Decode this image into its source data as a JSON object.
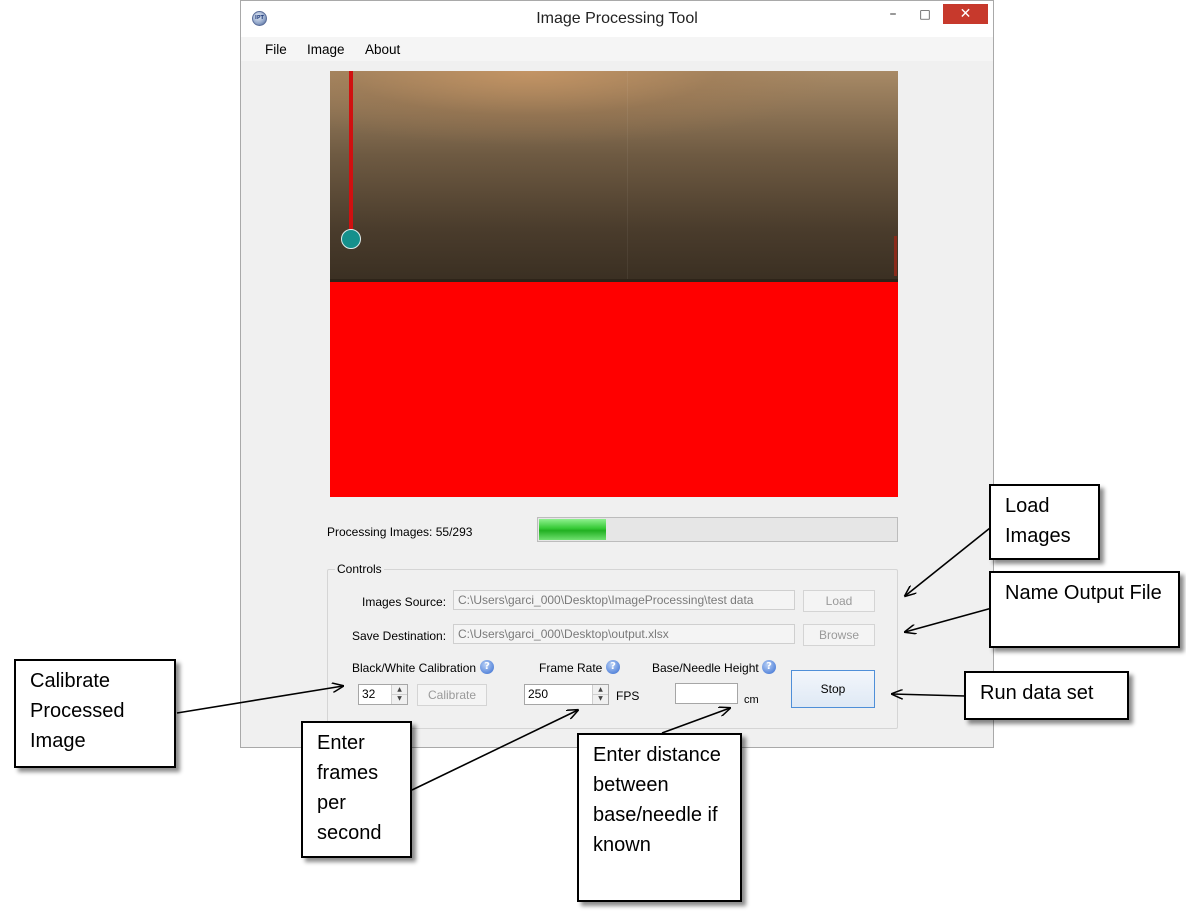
{
  "window": {
    "title": "Image Processing Tool",
    "app_icon_text": "IPT",
    "controls": {
      "minimize": "–",
      "maximize": "□",
      "close": "✕"
    }
  },
  "menu": [
    "File",
    "Image",
    "About"
  ],
  "progress": {
    "label": "Processing Images: 55/293",
    "processed": 55,
    "total": 293,
    "fraction": 0.1877
  },
  "controls": {
    "legend": "Controls",
    "images_source": {
      "label": "Images Source:",
      "value": "C:\\Users\\garci_000\\Desktop\\ImageProcessing\\test data",
      "button": "Load"
    },
    "save_destination": {
      "label": "Save Destination:",
      "value": "C:\\Users\\garci_000\\Desktop\\output.xlsx",
      "button": "Browse"
    },
    "calibration": {
      "label": "Black/White Calibration",
      "value": "32",
      "button": "Calibrate"
    },
    "frame_rate": {
      "label": "Frame Rate",
      "value": "250",
      "unit": "FPS"
    },
    "height": {
      "label": "Base/Needle Height",
      "value": "",
      "unit": "cm"
    },
    "run_button": "Stop",
    "help_glyph": "?"
  },
  "callouts": {
    "load_images": "Load Images",
    "name_output": "Name Output File",
    "run_data": "Run data set",
    "calibrate": "Calibrate Processed Image",
    "frames": "Enter frames per second",
    "distance": "Enter distance between base/needle if known"
  },
  "colors": {
    "threshold_red": "#ff0000",
    "needle_red": "#d01010",
    "droplet_teal": "#15908c",
    "progress_green": "#34c934",
    "close_button": "#c7392c"
  }
}
